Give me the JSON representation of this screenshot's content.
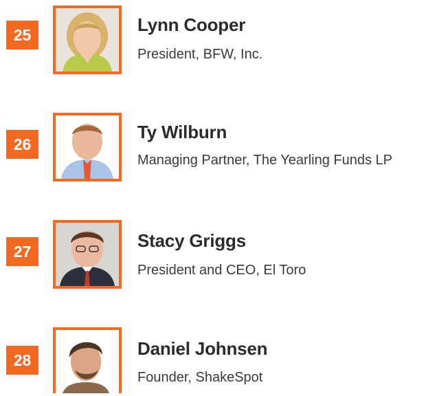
{
  "accent_color": "#f26a21",
  "entries": [
    {
      "rank": "25",
      "name": "Lynn Cooper",
      "title": "President, BFW, Inc.",
      "photo_icon": "headshot-photo"
    },
    {
      "rank": "26",
      "name": "Ty Wilburn",
      "title": "Managing Partner, The Yearling Funds LP",
      "photo_icon": "headshot-photo"
    },
    {
      "rank": "27",
      "name": "Stacy Griggs",
      "title": "President and CEO, El Toro",
      "photo_icon": "headshot-photo"
    },
    {
      "rank": "28",
      "name": "Daniel Johnsen",
      "title": "Founder, ShakeSpot",
      "photo_icon": "headshot-photo"
    }
  ]
}
